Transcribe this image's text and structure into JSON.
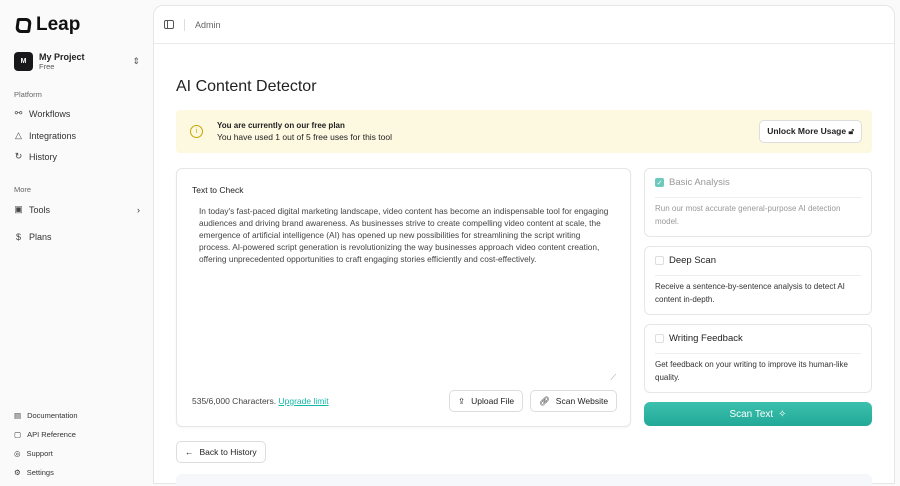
{
  "app": {
    "name": "Leap"
  },
  "project": {
    "initial": "M",
    "name": "My Project",
    "plan": "Free"
  },
  "sidebar": {
    "platform_label": "Platform",
    "platform": [
      {
        "label": "Workflows"
      },
      {
        "label": "Integrations"
      },
      {
        "label": "History"
      }
    ],
    "more_label": "More",
    "more": [
      {
        "label": "Tools"
      },
      {
        "label": "Plans"
      }
    ],
    "footer": [
      {
        "label": "Documentation"
      },
      {
        "label": "API Reference"
      },
      {
        "label": "Support"
      },
      {
        "label": "Settings"
      }
    ]
  },
  "header": {
    "breadcrumb": "Admin"
  },
  "page": {
    "title": "AI Content Detector"
  },
  "banner": {
    "title": "You are currently on our free plan",
    "text": "You have used 1 out of 5 free uses for this tool",
    "button": "Unlock More Usage"
  },
  "editor": {
    "label": "Text to Check",
    "value": "In today's fast-paced digital marketing landscape, video content has become an indispensable tool for engaging audiences and driving brand awareness. As businesses strive to create compelling video content at scale, the emergence of artificial intelligence (AI) has opened up new possibilities for streamlining the script writing process. AI-powered script generation is revolutionizing the way businesses approach video content creation, offering unprecedented opportunities to craft engaging stories efficiently and cost-effectively.",
    "count": "535/6,000 Characters.",
    "upgrade": "Upgrade limit",
    "upload": "Upload File",
    "scan_website": "Scan Website"
  },
  "options": [
    {
      "title": "Basic Analysis",
      "desc": "Run our most accurate general-purpose AI detection model.",
      "checked": true
    },
    {
      "title": "Deep Scan",
      "desc": "Receive a sentence-by-sentence analysis to detect AI content in-depth.",
      "checked": false
    },
    {
      "title": "Writing Feedback",
      "desc": "Get feedback on your writing to improve its human-like quality.",
      "checked": false
    }
  ],
  "scan_button": "Scan Text",
  "back_button": "Back to History",
  "colors": {
    "accent": "#2bb5a2",
    "banner": "#fdf8e0"
  }
}
